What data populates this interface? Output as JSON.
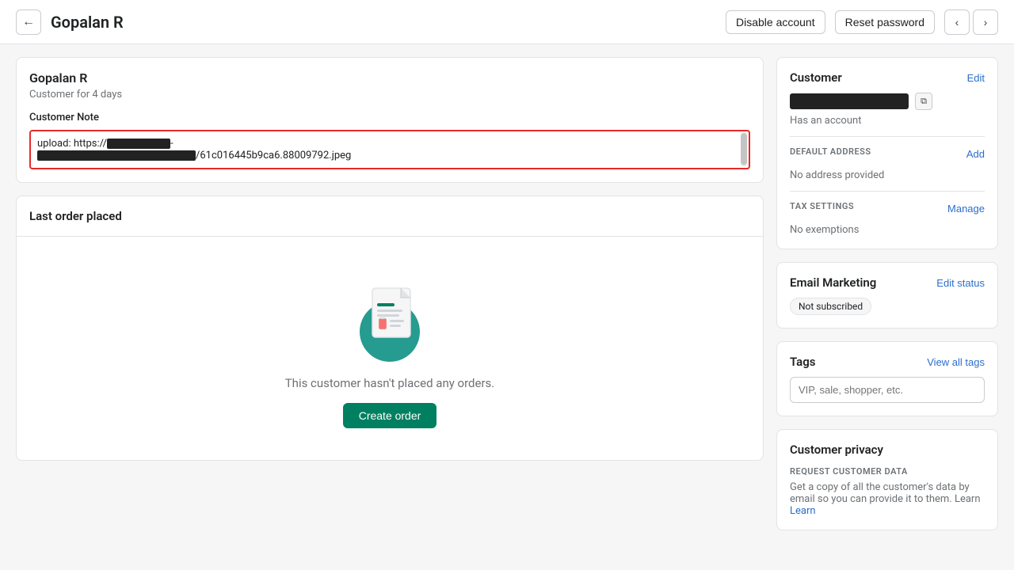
{
  "topBar": {
    "pageTitle": "Gopalan R",
    "backArrow": "←",
    "disableAccount": "Disable account",
    "resetPassword": "Reset password",
    "prevArrow": "‹",
    "nextArrow": "›"
  },
  "customerCard": {
    "name": "Gopalan R",
    "since": "Customer for 4 days",
    "noteLabel": "Customer Note",
    "noteText1": "upload: https://",
    "noteText2": "/61c016445b9ca6.88009792.jpeg"
  },
  "lastOrder": {
    "title": "Last order placed",
    "emptyText": "This customer hasn't placed any orders.",
    "createOrderBtn": "Create order"
  },
  "rightPanel": {
    "customerTitle": "Customer",
    "editLabel": "Edit",
    "hasAccount": "Has an account",
    "defaultAddressTitle": "DEFAULT ADDRESS",
    "addLabel": "Add",
    "noAddress": "No address provided",
    "taxSettingsTitle": "TAX SETTINGS",
    "manageLabel": "Manage",
    "noExemptions": "No exemptions",
    "emailMarketingTitle": "Email Marketing",
    "editStatusLabel": "Edit status",
    "notSubscribedBadge": "Not subscribed",
    "tagsTitle": "Tags",
    "viewAllTagsLabel": "View all tags",
    "tagsPlaceholder": "VIP, sale, shopper, etc.",
    "customerPrivacyTitle": "Customer privacy",
    "requestDataTitle": "REQUEST CUSTOMER DATA",
    "requestDataDesc": "Get a copy of all the customer's data by email so you can provide it to them. Learn"
  }
}
